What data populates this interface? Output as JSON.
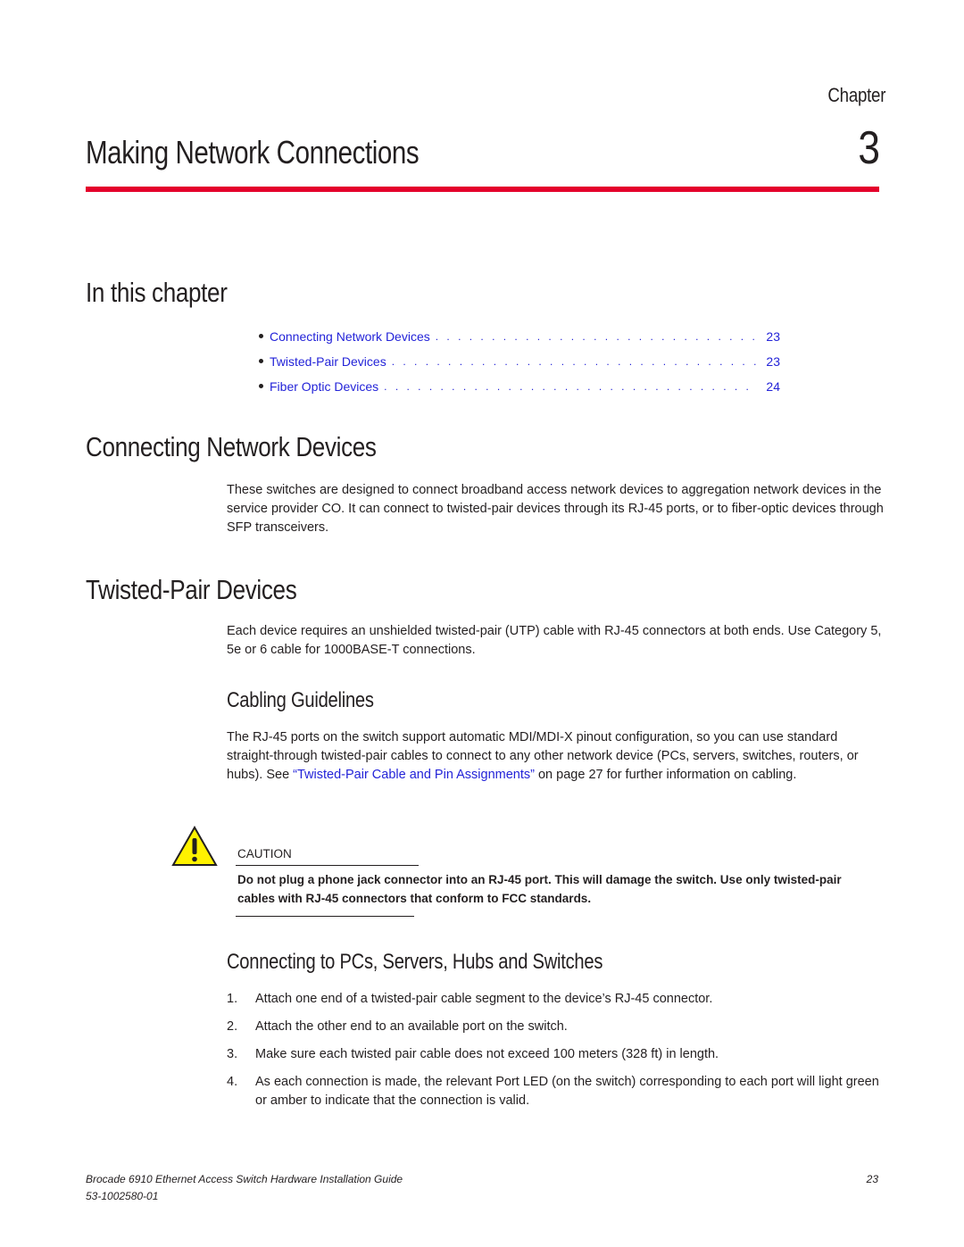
{
  "header": {
    "chapter_label": "Chapter",
    "chapter_number": "3",
    "chapter_title": "Making Network Connections",
    "rule_color": "#e4002b"
  },
  "in_this_chapter": {
    "heading": "In this chapter",
    "items": [
      {
        "title": "Connecting Network Devices",
        "page": "23"
      },
      {
        "title": "Twisted-Pair Devices",
        "page": "23"
      },
      {
        "title": "Fiber Optic Devices",
        "page": "24"
      }
    ]
  },
  "connecting_network_devices": {
    "heading": "Connecting Network Devices",
    "body": "These switches are designed to connect broadband access network devices to aggregation network devices in the service provider CO. It can connect to twisted-pair devices through its RJ-45 ports, or to fiber-optic devices through SFP transceivers."
  },
  "twisted_pair": {
    "heading": "Twisted-Pair Devices",
    "body": "Each device requires an unshielded twisted-pair (UTP) cable with RJ-45 connectors at both ends. Use Category 5, 5e or 6 cable for 1000BASE-T connections."
  },
  "cabling_guidelines": {
    "heading": "Cabling Guidelines",
    "body_before": "The RJ-45 ports on the switch support automatic MDI/MDI-X pinout configuration, so you can use standard straight-through twisted-pair cables to connect to any other network device (PCs, servers, switches, routers, or hubs). See ",
    "link_text": "“Twisted-Pair Cable and Pin Assignments”",
    "body_after": " on page 27 for further information on cabling."
  },
  "caution": {
    "icon": "warning-triangle-icon",
    "label": "CAUTION",
    "text": "Do not plug a phone jack connector into an RJ-45 port. This will damage the switch. Use only twisted-pair cables with RJ-45 connectors that conform to FCC standards."
  },
  "connecting_pcs": {
    "heading": "Connecting to PCs, Servers, Hubs and Switches",
    "steps": [
      {
        "num": "1.",
        "text": "Attach one end of a twisted-pair cable segment to the device’s RJ-45 connector."
      },
      {
        "num": "2.",
        "text": "Attach the other end to an available port on the switch."
      },
      {
        "num": "3.",
        "text": "Make sure each twisted pair cable does not exceed 100 meters (328 ft) in length."
      },
      {
        "num": "4.",
        "text": "As each connection is made, the relevant Port LED (on the switch) corresponding to each port will light green or amber to indicate that the connection is valid."
      }
    ]
  },
  "footer": {
    "title": "Brocade 6910 Ethernet Access Switch Hardware Installation Guide",
    "doc_number": "53-1002580-01",
    "page": "23"
  }
}
